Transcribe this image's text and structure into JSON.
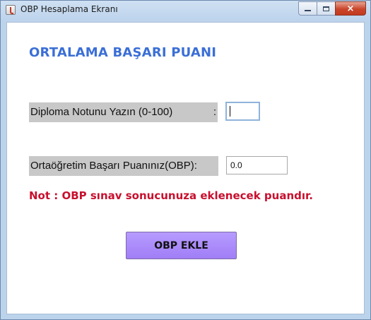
{
  "window": {
    "title": "OBP Hesaplama Ekranı",
    "icon": "java-cup-icon",
    "controls": {
      "minimize": "minimize-icon",
      "maximize": "maximize-icon",
      "close": "×"
    }
  },
  "form": {
    "heading": "ORTALAMA BAŞARI PUANI",
    "diploma_label": "Diploma Notunu Yazın (0-100)",
    "diploma_colon": ":",
    "diploma_value": "",
    "obp_label": "Ortaöğretim Başarı Puanınız(OBP):",
    "obp_value": "0.0",
    "note": "Not : OBP sınav sonucunuza eklenecek puandır.",
    "button_label": "OBP EKLE"
  },
  "colors": {
    "heading": "#3b6fd6",
    "note": "#c8102e",
    "button": "#a98bfa",
    "label_background": "#c8c8c8"
  }
}
